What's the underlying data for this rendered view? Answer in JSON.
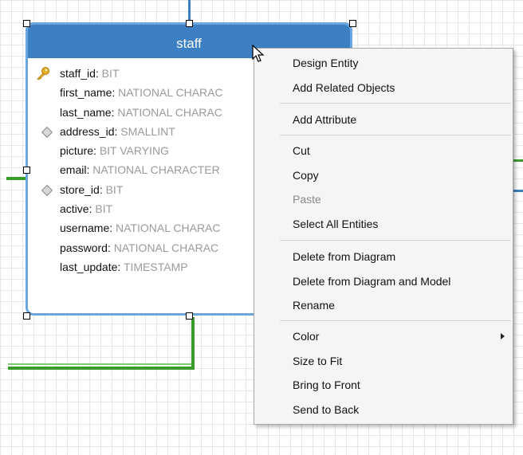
{
  "entity": {
    "name": "staff",
    "attributes": [
      {
        "name": "staff_id",
        "type": "BIT",
        "icon": "primary-key-icon"
      },
      {
        "name": "first_name",
        "type": "NATIONAL CHARAC",
        "icon": "none"
      },
      {
        "name": "last_name",
        "type": "NATIONAL CHARAC",
        "icon": "none"
      },
      {
        "name": "address_id",
        "type": "SMALLINT",
        "icon": "foreign-key-icon"
      },
      {
        "name": "picture",
        "type": "BIT VARYING",
        "icon": "none"
      },
      {
        "name": "email",
        "type": "NATIONAL CHARACTER",
        "icon": "none"
      },
      {
        "name": "store_id",
        "type": "BIT",
        "icon": "foreign-key-icon"
      },
      {
        "name": "active",
        "type": "BIT",
        "icon": "none"
      },
      {
        "name": "username",
        "type": "NATIONAL CHARAC",
        "icon": "none"
      },
      {
        "name": "password",
        "type": "NATIONAL CHARAC",
        "icon": "none"
      },
      {
        "name": "last_update",
        "type": "TIMESTAMP",
        "icon": "none"
      }
    ]
  },
  "context_menu": {
    "groups": [
      [
        "Design Entity",
        "Add Related Objects"
      ],
      [
        "Add Attribute"
      ],
      [
        "Cut",
        "Copy",
        "Paste",
        "Select All Entities"
      ],
      [
        "Delete from Diagram",
        "Delete from Diagram and Model",
        "Rename"
      ],
      [
        "Color",
        "Size to Fit",
        "Bring to Front",
        "Send to Back"
      ]
    ],
    "disabled": [
      "Paste"
    ],
    "submenu": [
      "Color"
    ]
  },
  "colors": {
    "header": "#3c7fc3",
    "entity_border": "#6aa6df",
    "relationship": "#3a9a2c",
    "attribute_type": "#9a9a9a"
  }
}
